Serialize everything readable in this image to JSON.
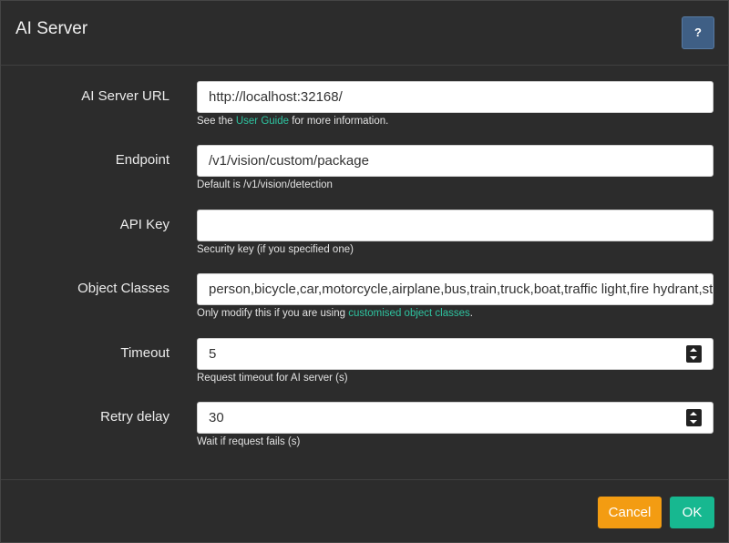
{
  "dialog": {
    "title": "AI Server",
    "help_label": "?"
  },
  "fields": {
    "server_url": {
      "label": "AI Server URL",
      "value": "http://localhost:32168/",
      "hint_prefix": "See the ",
      "hint_link": "User Guide",
      "hint_suffix": " for more information."
    },
    "endpoint": {
      "label": "Endpoint",
      "value": "/v1/vision/custom/package",
      "hint": "Default is /v1/vision/detection"
    },
    "api_key": {
      "label": "API Key",
      "value": "",
      "hint": "Security key (if you specified one)"
    },
    "object_classes": {
      "label": "Object Classes",
      "value": "person,bicycle,car,motorcycle,airplane,bus,train,truck,boat,traffic light,fire hydrant,stop sign",
      "hint_prefix": "Only modify this if you are using ",
      "hint_link": "customised object classes",
      "hint_suffix": "."
    },
    "timeout": {
      "label": "Timeout",
      "value": "5",
      "hint": "Request timeout for AI server (s)"
    },
    "retry_delay": {
      "label": "Retry delay",
      "value": "30",
      "hint": "Wait if request fails (s)"
    }
  },
  "footer": {
    "cancel_label": "Cancel",
    "ok_label": "OK"
  },
  "colors": {
    "background": "#2c2c2c",
    "help": "#3f5f85",
    "cancel": "#f39c12",
    "ok": "#17b890",
    "link": "#2ec3a0"
  }
}
